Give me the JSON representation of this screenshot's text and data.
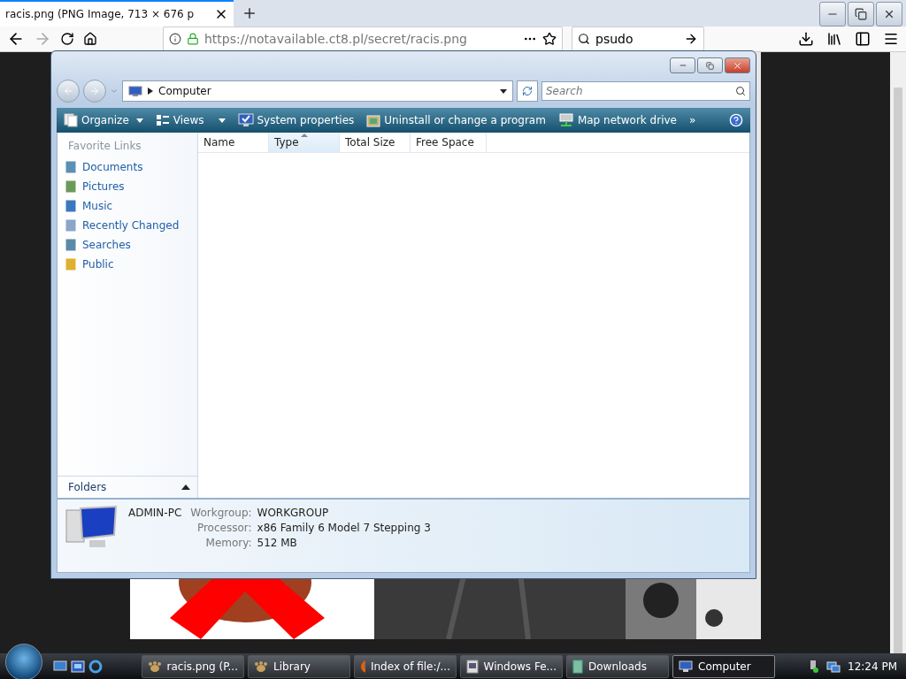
{
  "browser": {
    "tabs": [
      {
        "title": "racis.png (PNG Image, 713 × 676 p",
        "selected": true
      }
    ],
    "url": "https://notavailable.ct8.pl/secret/racis.png",
    "search": "psudo"
  },
  "explorer": {
    "address": "Computer",
    "search_placeholder": "Search",
    "toolbar": [
      {
        "label": "Organize",
        "dropdown": true,
        "kind": "organize"
      },
      {
        "label": "Views",
        "dropdown": true,
        "kind": "views"
      },
      {
        "label": "System properties",
        "dropdown": false,
        "kind": "system"
      },
      {
        "label": "Uninstall or change a program",
        "dropdown": false,
        "kind": "uninstall"
      },
      {
        "label": "Map network drive",
        "dropdown": false,
        "kind": "network"
      }
    ],
    "overflow": "»",
    "columns": [
      {
        "label": "Name",
        "sorted": false
      },
      {
        "label": "Type",
        "sorted": true
      },
      {
        "label": "Total Size",
        "sorted": false
      },
      {
        "label": "Free Space",
        "sorted": false
      }
    ],
    "favorites_heading": "Favorite Links",
    "links": [
      {
        "label": "Documents",
        "kind": "documents"
      },
      {
        "label": "Pictures",
        "kind": "pictures"
      },
      {
        "label": "Music",
        "kind": "music"
      },
      {
        "label": "Recently Changed",
        "kind": "recent"
      },
      {
        "label": "Searches",
        "kind": "searches"
      },
      {
        "label": "Public",
        "kind": "public"
      }
    ],
    "folders": "Folders",
    "details": {
      "name": "ADMIN-PC",
      "fields": [
        {
          "label": "Workgroup:",
          "value": "WORKGROUP"
        },
        {
          "label": "Processor:",
          "value": "x86 Family 6 Model 7 Stepping 3"
        },
        {
          "label": "Memory:",
          "value": "512 MB"
        }
      ]
    }
  },
  "taskbar": {
    "items": [
      {
        "label": "racis.png (P...",
        "selected": false,
        "kind": "library"
      },
      {
        "label": "Library",
        "selected": false,
        "kind": "library"
      },
      {
        "label": "Index of file:/...",
        "selected": false,
        "kind": "firefox"
      },
      {
        "label": "Windows Fe...",
        "selected": false,
        "kind": "feature"
      },
      {
        "label": "Downloads",
        "selected": false,
        "kind": "downloads"
      },
      {
        "label": "Computer",
        "selected": true,
        "kind": "computer"
      }
    ],
    "clock": "12:24 PM"
  }
}
